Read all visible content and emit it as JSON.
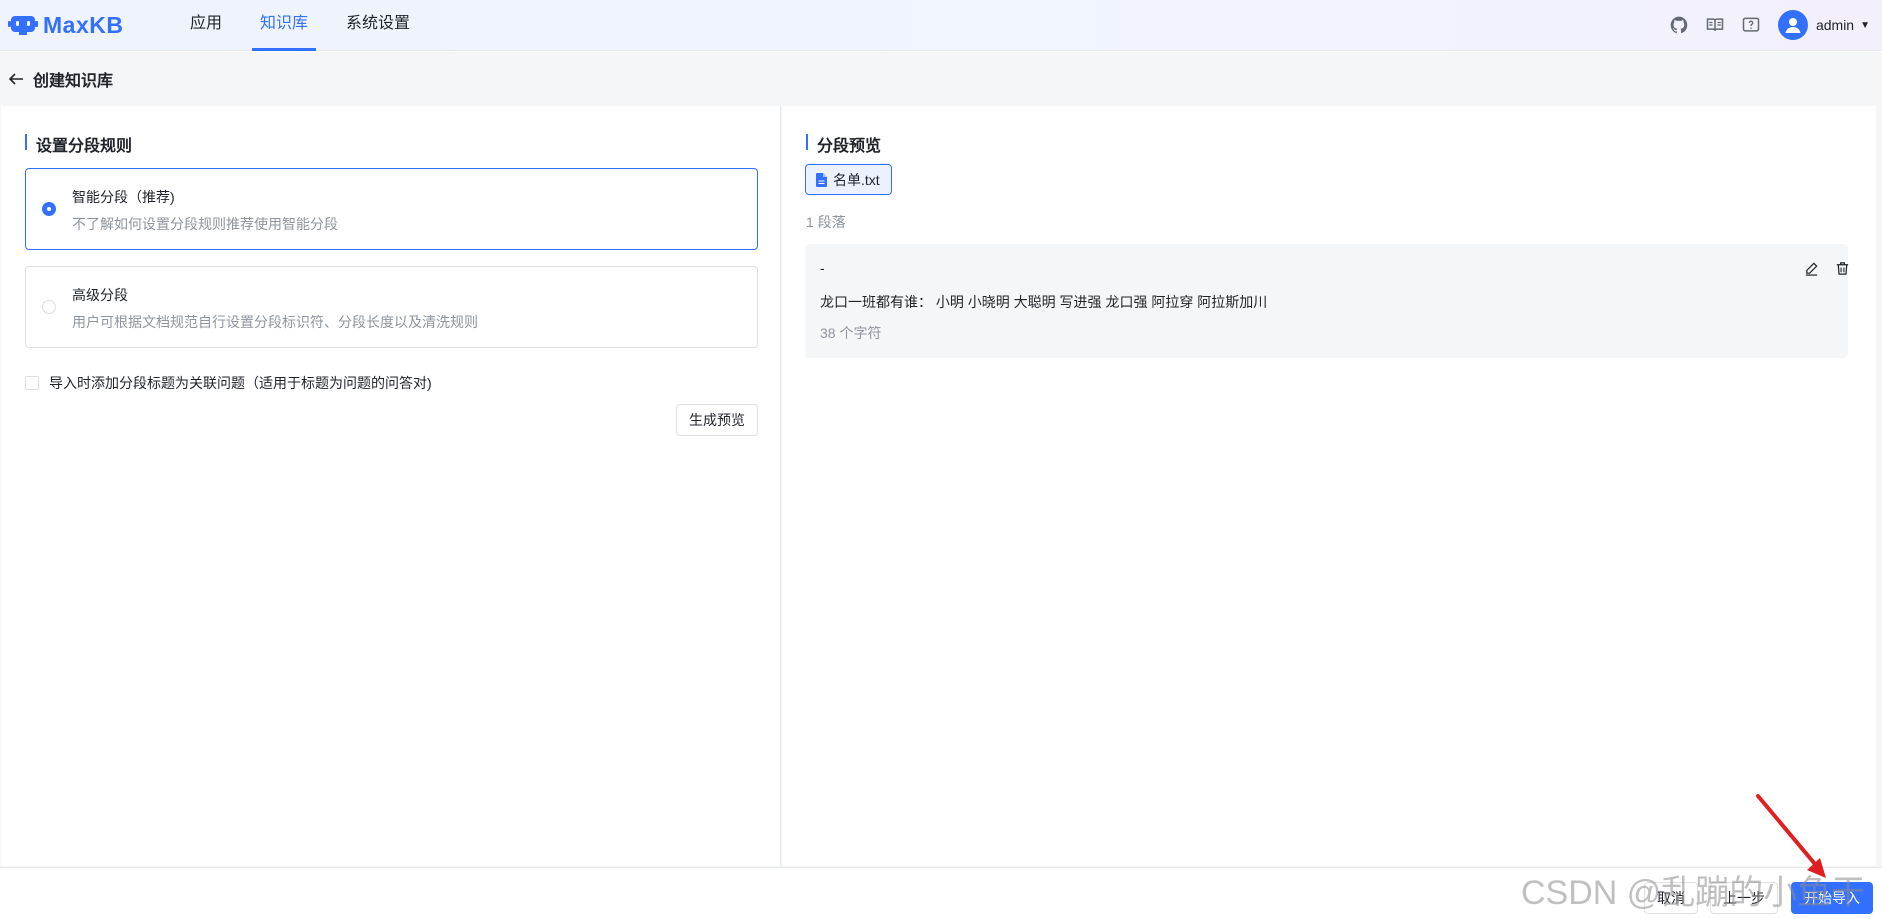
{
  "app": {
    "name": "MaxKB"
  },
  "nav": {
    "items": [
      {
        "label": "应用",
        "active": false
      },
      {
        "label": "知识库",
        "active": true
      },
      {
        "label": "系统设置",
        "active": false
      }
    ]
  },
  "header": {
    "icons": [
      "github-icon",
      "book-icon",
      "help-icon"
    ],
    "username": "admin"
  },
  "page": {
    "title": "创建知识库"
  },
  "rules": {
    "title": "设置分段规则",
    "options": [
      {
        "title": "智能分段（推荐)",
        "desc": "不了解如何设置分段规则推荐使用智能分段",
        "selected": true
      },
      {
        "title": "高级分段",
        "desc": "用户可根据文档规范自行设置分段标识符、分段长度以及清洗规则",
        "selected": false
      }
    ],
    "checkbox_label": "导入时添加分段标题为关联问题（适用于标题为问题的问答对)",
    "preview_button": "生成预览"
  },
  "preview": {
    "title": "分段预览",
    "file_name": "名单.txt",
    "segment_count": "1 段落",
    "segment": {
      "title": "-",
      "content": "龙口一班都有谁：  小明 小晓明 大聪明 写进强 龙口强 阿拉穿 阿拉斯加川",
      "chars": "38 个字符"
    }
  },
  "footer": {
    "cancel_label": "取消",
    "prev_label": "上一步",
    "start_label": "开始导入"
  },
  "watermark": "CSDN @乱蹦的小鱼干",
  "colors": {
    "accent": "#3370ff",
    "arrow": "#e02020"
  }
}
